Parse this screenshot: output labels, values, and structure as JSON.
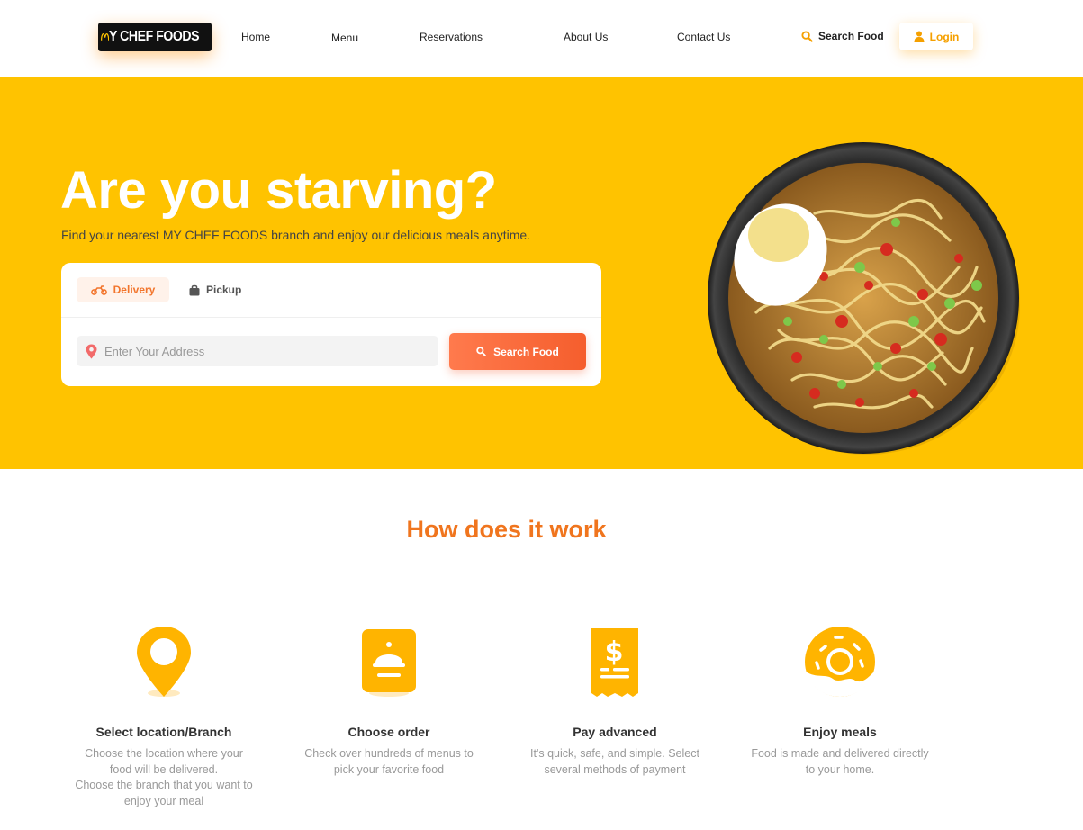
{
  "brand": {
    "logo_text": "Y CHEF FOODS",
    "accent": "#ffc300",
    "orange": "#f0751e"
  },
  "nav": {
    "links": [
      "Home",
      "Menu",
      "Reservations",
      "About Us",
      "Contact Us"
    ],
    "search_label": "Search Food",
    "login_label": "Login"
  },
  "hero": {
    "title": "Are you starving?",
    "subtitle": "Find your nearest MY CHEF FOODS branch and enjoy our delicious meals anytime.",
    "tabs": {
      "delivery": "Delivery",
      "pickup": "Pickup"
    },
    "address_placeholder": "Enter Your Address",
    "search_button": "Search Food"
  },
  "how": {
    "title": "How does it work",
    "steps": [
      {
        "title": "Select location/Branch",
        "desc": "Choose the location where your\nfood will be delivered.\nChoose the branch that you want to\nenjoy your meal",
        "icon": "location-pin-icon"
      },
      {
        "title": "Choose order",
        "desc": "Check over hundreds of menus to\npick your favorite food",
        "icon": "food-cloche-icon"
      },
      {
        "title": "Pay advanced",
        "desc": "It's quick, safe, and simple. Select\nseveral methods of payment",
        "icon": "receipt-dollar-icon"
      },
      {
        "title": "Enjoy meals",
        "desc": "Food is made and delivered directly\nto your home.",
        "icon": "donut-icon"
      }
    ]
  }
}
